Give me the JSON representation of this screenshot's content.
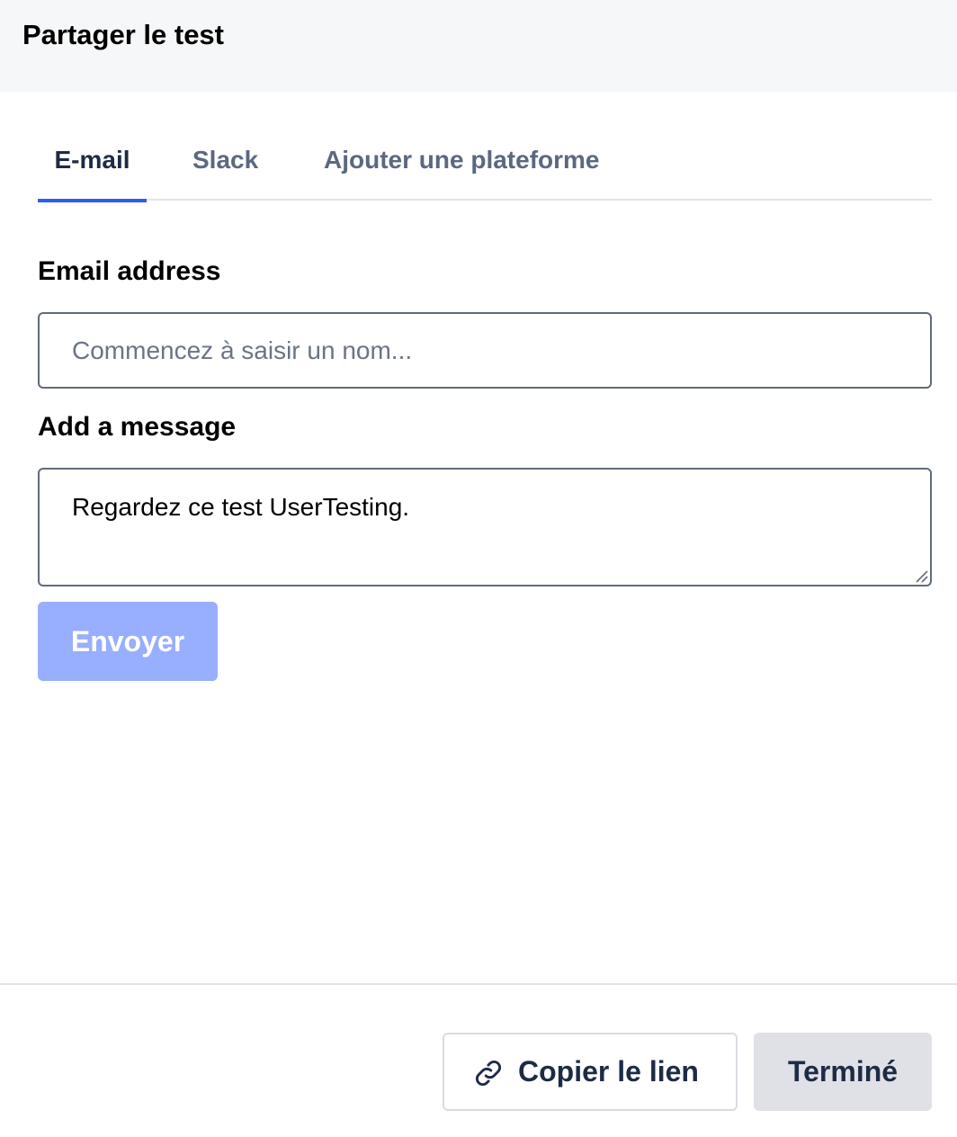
{
  "dialog": {
    "title": "Partager le test"
  },
  "tabs": [
    {
      "label": "E-mail",
      "active": true
    },
    {
      "label": "Slack",
      "active": false
    },
    {
      "label": "Ajouter une plateforme",
      "active": false
    }
  ],
  "form": {
    "email_label": "Email address",
    "email_placeholder": "Commencez à saisir un nom...",
    "email_value": "",
    "message_label": "Add a message",
    "message_value": "Regardez ce test UserTesting.",
    "send_label": "Envoyer"
  },
  "footer": {
    "copy_link_label": "Copier le lien",
    "copy_link_icon": "link-icon",
    "done_label": "Terminé"
  },
  "colors": {
    "accent": "#2f5cf0",
    "send_disabled": "#98aefe",
    "header_bg": "#f6f7f8",
    "text_dark": "#1d2b45",
    "tab_inactive": "#5b6880"
  }
}
